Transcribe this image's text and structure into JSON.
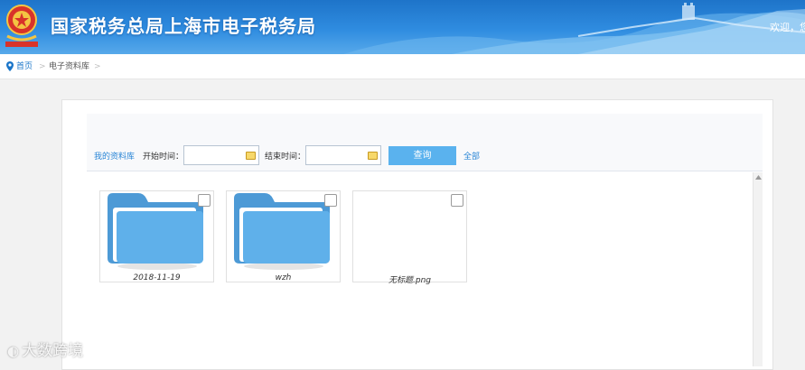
{
  "header": {
    "title": "国家税务总局上海市电子税务局",
    "welcome": "欢迎，您",
    "emblem_icon": "tax-emblem-icon"
  },
  "breadcrumb": {
    "home": "首页",
    "current": "电子资料库",
    "separator": ">"
  },
  "toolbar": {
    "my_library": "我的资料库",
    "start_label": "开始时间：",
    "start_value": "",
    "end_label": "结束时间：",
    "end_value": "",
    "query_button": "查询",
    "all_link": "全部",
    "calendar_icon": "calendar-icon"
  },
  "files": [
    {
      "name": "2018-11-19",
      "type": "folder",
      "checked": false
    },
    {
      "name": "wzh",
      "type": "folder",
      "checked": false
    },
    {
      "name": "无标题.png",
      "type": "image",
      "checked": false
    }
  ],
  "watermark": {
    "text": "大数跨境"
  },
  "colors": {
    "header_blue": "#2f8ce0",
    "link_blue": "#2a86d6",
    "button_blue": "#5ab2ee",
    "folder_blue": "#57a6e0"
  }
}
